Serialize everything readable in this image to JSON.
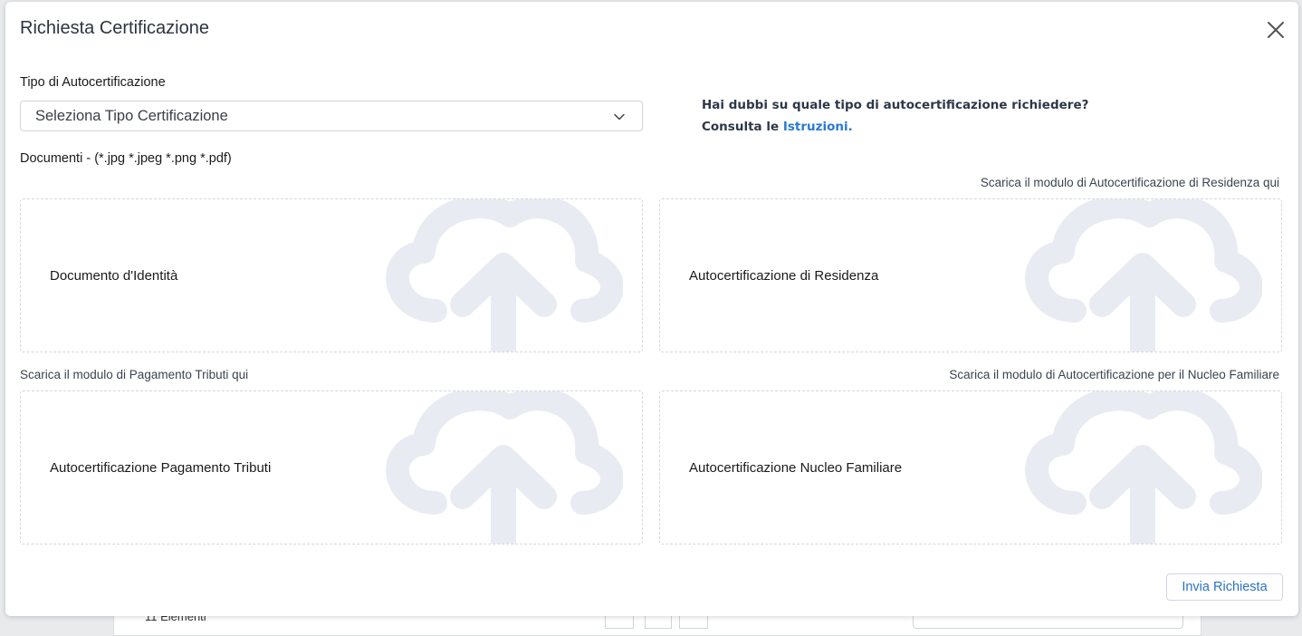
{
  "modal": {
    "title": "Richiesta Certificazione"
  },
  "form": {
    "type_label": "Tipo di Autocertificazione",
    "type_select_value": "Seleziona Tipo Certificazione",
    "documents_label": "Documenti - (*.jpg *.jpeg *.png *.pdf)"
  },
  "help": {
    "question": "Hai dubbi su quale tipo di autocertificazione richiedere?",
    "consult_prefix": "Consulta le ",
    "link_text": "Istruzioni."
  },
  "downloads": {
    "residenza": "Scarica il modulo di Autocertificazione di Residenza qui",
    "tributi": "Scarica il modulo di Pagamento Tributi qui",
    "nucleo": "Scarica il modulo di Autocertificazione per il Nucleo Familiare"
  },
  "dropzones": [
    {
      "label": "Documento d'Identità"
    },
    {
      "label": "Autocertificazione di Residenza"
    },
    {
      "label": "Autocertificazione Pagamento Tributi"
    },
    {
      "label": "Autocertificazione Nucleo Familiare"
    }
  ],
  "actions": {
    "submit_label": "Invia Richiesta"
  },
  "background": {
    "count_text": "11 Elementi"
  },
  "colors": {
    "link": "#2a7ad6",
    "cloud_icon": "#e8ecf2"
  },
  "icons": {
    "close": "close-icon",
    "chevron": "chevron-down-icon",
    "upload": "cloud-upload-icon"
  }
}
